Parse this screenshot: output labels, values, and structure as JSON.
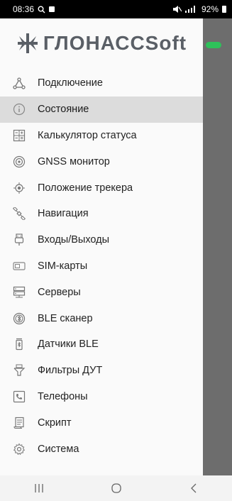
{
  "status": {
    "time": "08:36",
    "battery": "92%"
  },
  "logo": {
    "text_cyr": "ГЛОНАСС",
    "text_lat": "Soft"
  },
  "menu": {
    "items": [
      {
        "label": "Подключение",
        "icon": "connection-icon"
      },
      {
        "label": "Состояние",
        "icon": "info-icon",
        "active": true
      },
      {
        "label": "Калькулятор статуса",
        "icon": "calculator-icon"
      },
      {
        "label": "GNSS монитор",
        "icon": "gnss-monitor-icon"
      },
      {
        "label": "Положение трекера",
        "icon": "location-icon"
      },
      {
        "label": "Навигация",
        "icon": "satellite-icon"
      },
      {
        "label": "Входы/Выходы",
        "icon": "plug-icon"
      },
      {
        "label": "SIM-карты",
        "icon": "sim-card-icon"
      },
      {
        "label": "Серверы",
        "icon": "server-icon"
      },
      {
        "label": "BLE сканер",
        "icon": "bluetooth-scan-icon"
      },
      {
        "label": "Датчики BLE",
        "icon": "bluetooth-sensor-icon"
      },
      {
        "label": "Фильтры ДУТ",
        "icon": "fuel-filter-icon"
      },
      {
        "label": "Телефоны",
        "icon": "phone-icon"
      },
      {
        "label": "Скрипт",
        "icon": "script-icon"
      },
      {
        "label": "Система",
        "icon": "settings-icon"
      }
    ]
  },
  "colors": {
    "accent_pill": "#2ec15a",
    "active_bg": "#dcdcdc"
  }
}
